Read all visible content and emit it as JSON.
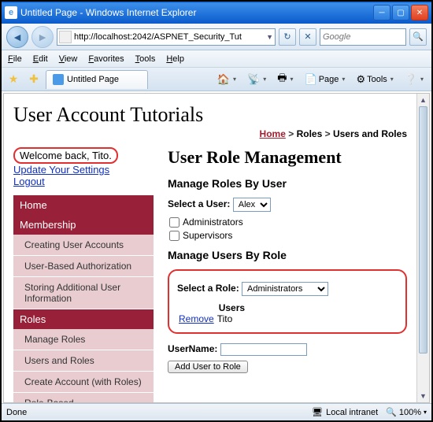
{
  "window": {
    "title": "Untitled Page - Windows Internet Explorer",
    "url": "http://localhost:2042/ASPNET_Security_Tut",
    "search_placeholder": "Google"
  },
  "menubar": [
    "File",
    "Edit",
    "View",
    "Favorites",
    "Tools",
    "Help"
  ],
  "tab": {
    "label": "Untitled Page"
  },
  "toolbar": {
    "home": "",
    "feeds": "",
    "print": "",
    "page": "Page",
    "tools": "Tools"
  },
  "page": {
    "title": "User Account Tutorials",
    "breadcrumb": {
      "home": "Home",
      "sep": " > ",
      "roles": "Roles",
      "current": "Users and Roles"
    },
    "welcome": "Welcome back, Tito.",
    "links": {
      "update": "Update Your Settings",
      "logout": "Logout"
    }
  },
  "sidenav": [
    {
      "type": "head",
      "label": "Home"
    },
    {
      "type": "head",
      "label": "Membership"
    },
    {
      "type": "item",
      "label": "Creating User Accounts"
    },
    {
      "type": "item",
      "label": "User-Based Authorization"
    },
    {
      "type": "item",
      "label": "Storing Additional User Information"
    },
    {
      "type": "head",
      "label": "Roles"
    },
    {
      "type": "item",
      "label": "Manage Roles"
    },
    {
      "type": "item",
      "label": "Users and Roles"
    },
    {
      "type": "item",
      "label": "Create Account (with Roles)"
    },
    {
      "type": "item",
      "label": "Role-Based"
    }
  ],
  "main": {
    "h1": "User Role Management",
    "byUser": {
      "heading": "Manage Roles By User",
      "selectLabel": "Select a User:",
      "selected": "Alex",
      "roles": [
        {
          "name": "Administrators",
          "checked": false
        },
        {
          "name": "Supervisors",
          "checked": false
        }
      ]
    },
    "byRole": {
      "heading": "Manage Users By Role",
      "selectLabel": "Select a Role:",
      "selected": "Administrators",
      "table": {
        "headerAction": "",
        "headerUsers": "Users",
        "rows": [
          {
            "action": "Remove",
            "user": "Tito"
          }
        ]
      }
    },
    "addUser": {
      "label": "UserName:",
      "value": "",
      "button": "Add User to Role"
    }
  },
  "status": {
    "done": "Done",
    "zone": "Local intranet",
    "zoom": "100%"
  }
}
